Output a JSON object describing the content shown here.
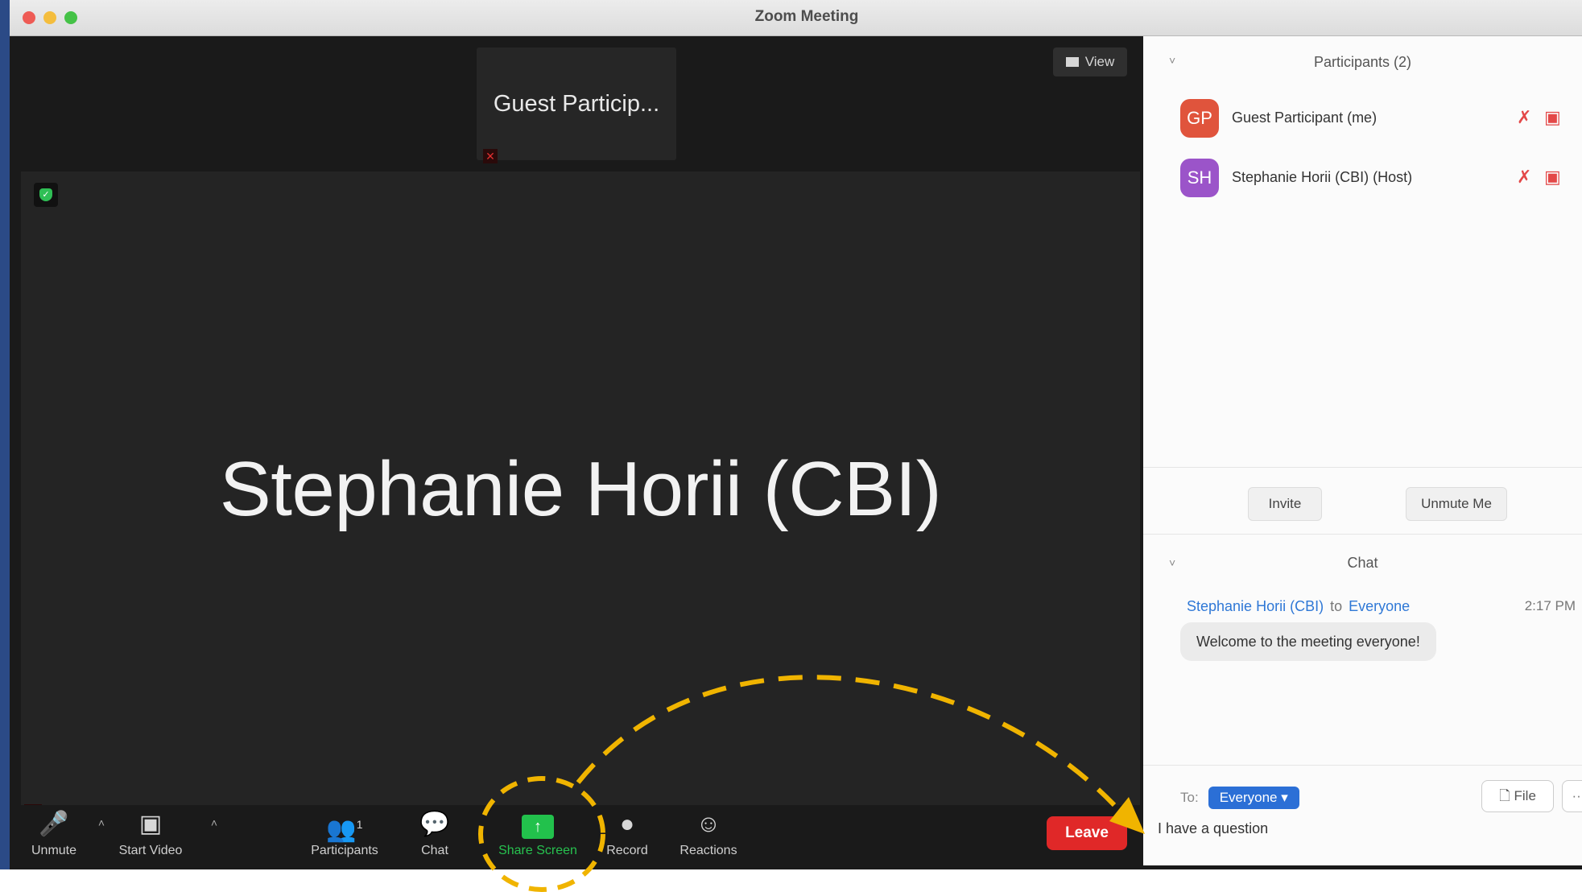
{
  "window": {
    "title": "Zoom Meeting"
  },
  "stage": {
    "thumbnail_name": "Guest Particip...",
    "view_label": "View",
    "speaker_name": "Stephanie Horii (CBI)"
  },
  "toolbar": {
    "unmute": "Unmute",
    "start_video": "Start Video",
    "participants": "Participants",
    "participants_count": "1",
    "chat": "Chat",
    "share_screen": "Share Screen",
    "record": "Record",
    "reactions": "Reactions",
    "leave": "Leave"
  },
  "participants_panel": {
    "title": "Participants (2)",
    "items": [
      {
        "initials": "GP",
        "name": "Guest Participant (me)",
        "color": "#e0543c"
      },
      {
        "initials": "SH",
        "name": "Stephanie Horii (CBI) (Host)",
        "color": "#9b54c9"
      }
    ],
    "invite_label": "Invite",
    "unmute_me_label": "Unmute Me"
  },
  "chat_panel": {
    "title": "Chat",
    "message": {
      "sender": "Stephanie Horii (CBI)",
      "to_word": "to",
      "recipient": "Everyone",
      "time": "2:17 PM",
      "text": "Welcome to the meeting everyone!"
    },
    "to_label": "To:",
    "to_value": "Everyone",
    "file_label": "File",
    "more_label": "···",
    "input_text": "I have a question"
  },
  "annotation": {
    "color": "#f0b400"
  }
}
